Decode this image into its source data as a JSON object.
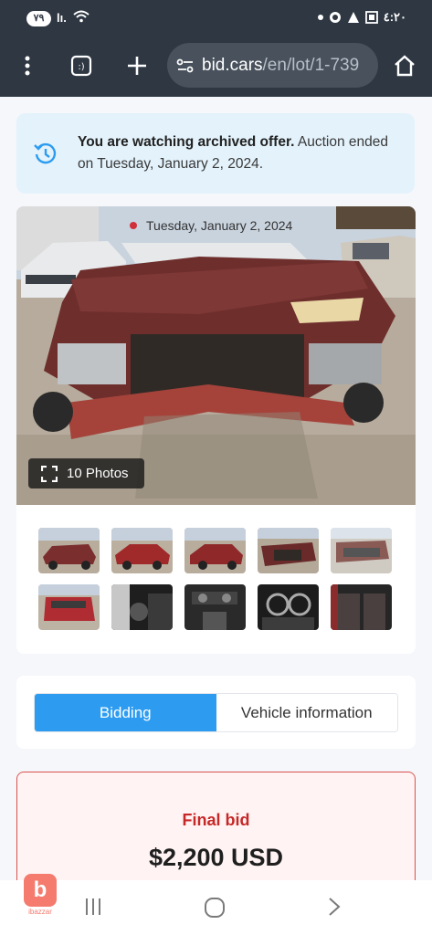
{
  "status_bar": {
    "badge": "٧٩",
    "signal": "lı.",
    "time": "٤:٢٠"
  },
  "browser": {
    "url_host": "bid.cars",
    "url_path": "/en/lot/1-739",
    "tab_count": ":)"
  },
  "notice": {
    "bold": "You are watching archived offer.",
    "text": " Auction ended on Tuesday, January 2, 2024."
  },
  "gallery": {
    "date": "Tuesday, January 2, 2024",
    "photos_label": "10 Photos",
    "thumbnail_count": 10
  },
  "tabs": [
    {
      "label": "Bidding",
      "active": true
    },
    {
      "label": "Vehicle information",
      "active": false
    }
  ],
  "final_bid": {
    "label": "Final bid",
    "value": "$2,200 USD"
  },
  "watermark": {
    "logo_letter": "b",
    "logo_text": "ibazzar"
  },
  "colors": {
    "toolbar_bg": "#2e3742",
    "accent": "#2d9cf0",
    "bid_red": "#c62828",
    "notice_bg": "#e3f2fb"
  },
  "icons": [
    "history-icon",
    "expand-icon",
    "home-icon",
    "plus-icon",
    "more-vert-icon",
    "site-settings-icon"
  ]
}
